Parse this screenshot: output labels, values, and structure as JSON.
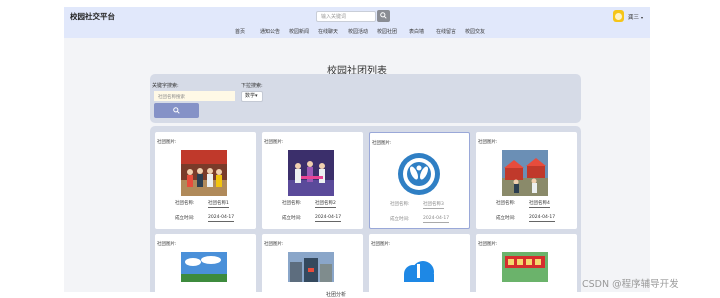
{
  "app": {
    "brand": "校园社交平台"
  },
  "header": {
    "search_placeholder": "输入关键词",
    "user_name": "龚三",
    "caret": "▾"
  },
  "nav": {
    "items": [
      "首页",
      "通知公告",
      "校园新闻",
      "在线聊天",
      "校园活动",
      "校园社团",
      "表白墙",
      "在线留言",
      "校园交友"
    ]
  },
  "main": {
    "title": "校园社团列表"
  },
  "search_panel": {
    "keyword_label": "关键字搜索:",
    "keyword_placeholder": "社团名称搜索",
    "dropdown_label": "下拉搜索:",
    "dropdown_value": "数学▾"
  },
  "clubs": [
    {
      "img_label": "社团图片:",
      "name_label": "社团名称:",
      "name": "社团名称1",
      "date_label": "成立时间:",
      "date": "2024-04-17"
    },
    {
      "img_label": "社团图片:",
      "name_label": "社团名称:",
      "name": "社团名称2",
      "date_label": "成立时间:",
      "date": "2024-04-17"
    },
    {
      "img_label": "社团图片:",
      "name_label": "社团名称:",
      "name": "社团名称3",
      "date_label": "成立时间:",
      "date": "2024-04-17"
    },
    {
      "img_label": "社团图片:",
      "name_label": "社团名称:",
      "name": "社团名称4",
      "date_label": "成立时间:",
      "date": "2024-04-17"
    },
    {
      "img_label": "社团图片:"
    },
    {
      "img_label": "社团图片:"
    },
    {
      "img_label": "社团图片:"
    },
    {
      "img_label": "社团图片:"
    }
  ],
  "watermark": "CSDN @程序辅导开发",
  "bottom_text": "社团分析"
}
